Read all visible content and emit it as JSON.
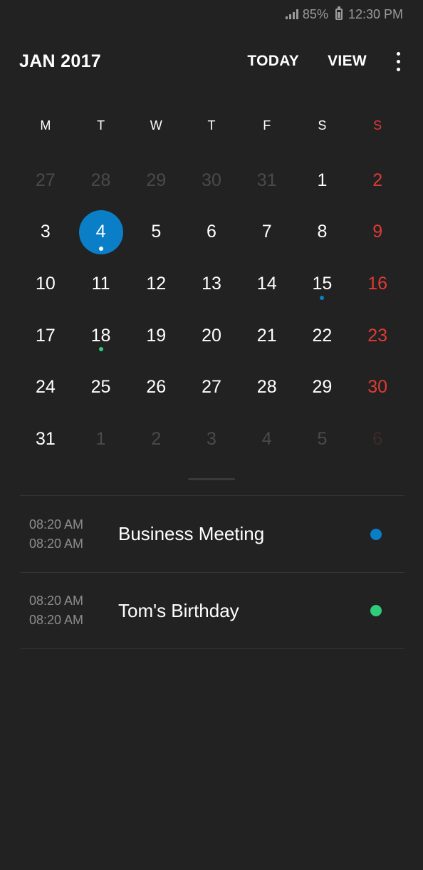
{
  "status_bar": {
    "battery": "85%",
    "time": "12:30 PM"
  },
  "header": {
    "month_title": "JAN 2017",
    "today_label": "TODAY",
    "view_label": "VIEW"
  },
  "weekdays": [
    "M",
    "T",
    "W",
    "T",
    "F",
    "S",
    "S"
  ],
  "calendar": {
    "weeks": [
      [
        {
          "day": "27",
          "dim": true
        },
        {
          "day": "28",
          "dim": true
        },
        {
          "day": "29",
          "dim": true
        },
        {
          "day": "30",
          "dim": true
        },
        {
          "day": "31",
          "dim": true
        },
        {
          "day": "1"
        },
        {
          "day": "2",
          "sunday": true
        }
      ],
      [
        {
          "day": "3"
        },
        {
          "day": "4",
          "selected": true,
          "dot": "#ffffff"
        },
        {
          "day": "5"
        },
        {
          "day": "6"
        },
        {
          "day": "7"
        },
        {
          "day": "8"
        },
        {
          "day": "9",
          "sunday": true
        }
      ],
      [
        {
          "day": "10"
        },
        {
          "day": "11"
        },
        {
          "day": "12"
        },
        {
          "day": "13"
        },
        {
          "day": "14"
        },
        {
          "day": "15",
          "dot": "#0a7fc8"
        },
        {
          "day": "16",
          "sunday": true
        }
      ],
      [
        {
          "day": "17"
        },
        {
          "day": "18",
          "dot": "#2fcc7a"
        },
        {
          "day": "19"
        },
        {
          "day": "20"
        },
        {
          "day": "21"
        },
        {
          "day": "22"
        },
        {
          "day": "23",
          "sunday": true
        }
      ],
      [
        {
          "day": "24"
        },
        {
          "day": "25"
        },
        {
          "day": "26"
        },
        {
          "day": "27"
        },
        {
          "day": "28"
        },
        {
          "day": "29"
        },
        {
          "day": "30",
          "sunday": true
        }
      ],
      [
        {
          "day": "31"
        },
        {
          "day": "1",
          "dim": true
        },
        {
          "day": "2",
          "dim": true
        },
        {
          "day": "3",
          "dim": true
        },
        {
          "day": "4",
          "dim": true
        },
        {
          "day": "5",
          "dim": true
        },
        {
          "day": "6",
          "dim": true,
          "sunday": true
        }
      ]
    ]
  },
  "events": [
    {
      "start": "08:20 AM",
      "end": "08:20 AM",
      "title": "Business Meeting",
      "color": "#0a7fc8"
    },
    {
      "start": "08:20 AM",
      "end": "08:20 AM",
      "title": "Tom's Birthday",
      "color": "#2fcc7a"
    }
  ],
  "colors": {
    "background": "#222222",
    "accent": "#0a7fc8",
    "sunday": "#e03a35",
    "birthday_green": "#2fcc7a"
  }
}
